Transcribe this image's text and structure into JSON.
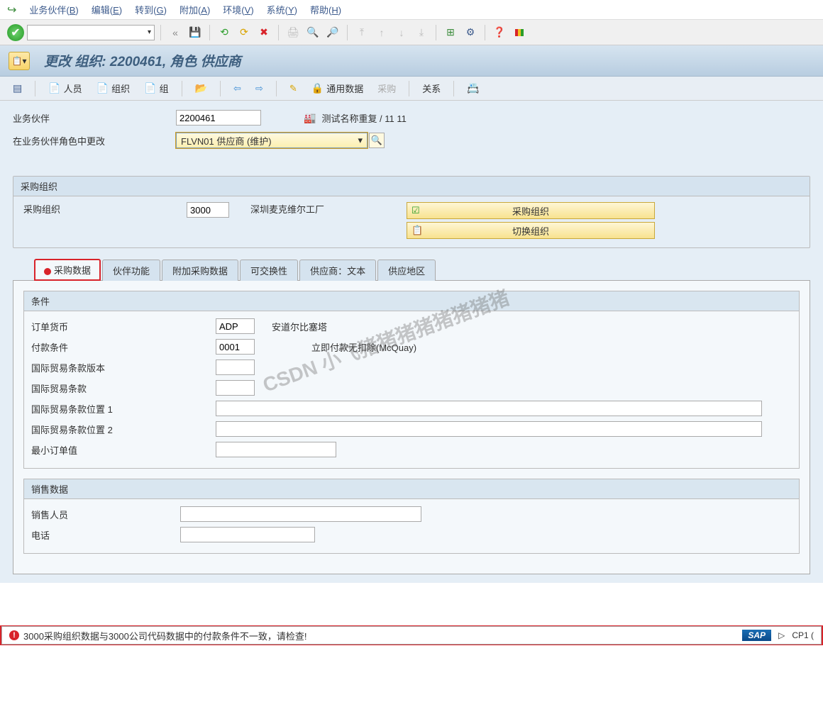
{
  "menubar": {
    "items": [
      {
        "label": "业务伙伴(",
        "key": "B",
        "suffix": ")"
      },
      {
        "label": "编辑(",
        "key": "E",
        "suffix": ")"
      },
      {
        "label": "转到(",
        "key": "G",
        "suffix": ")"
      },
      {
        "label": "附加(",
        "key": "A",
        "suffix": ")"
      },
      {
        "label": "环境(",
        "key": "V",
        "suffix": ")"
      },
      {
        "label": "系统(",
        "key": "Y",
        "suffix": ")"
      },
      {
        "label": "帮助(",
        "key": "H",
        "suffix": ")"
      }
    ]
  },
  "title": "更改 组织: 2200461, 角色 供应商",
  "apptool": {
    "person": "人员",
    "org": "组织",
    "group": "组",
    "general": "通用数据",
    "purchase": "采购",
    "relation": "关系"
  },
  "header_form": {
    "partner_label": "业务伙伴",
    "partner_value": "2200461",
    "partner_desc": "测试名称重复 / 11 11",
    "role_label": "在业务伙伴角色中更改",
    "role_value": "FLVN01 供应商 (维护)"
  },
  "purch_org": {
    "group_title": "采购组织",
    "label": "采购组织",
    "value": "3000",
    "desc": "深圳麦克维尔工厂",
    "btn1": "采购组织",
    "btn2": "切换组织"
  },
  "tabs": {
    "t1": "采购数据",
    "t2": "伙伴功能",
    "t3": "附加采购数据",
    "t4": "可交换性",
    "t5": "供应商：文本",
    "t6": "供应地区"
  },
  "cond_group": {
    "title": "条件",
    "order_currency_label": "订单货币",
    "order_currency_value": "ADP",
    "order_currency_desc": "安道尔比塞塔",
    "pay_terms_label": "付款条件",
    "pay_terms_value": "0001",
    "pay_terms_desc": "立即付款无扣除(McQuay)",
    "incoterms_ver_label": "国际贸易条款版本",
    "incoterms_label": "国际贸易条款",
    "incoterms_loc1_label": "国际贸易条款位置 1",
    "incoterms_loc2_label": "国际贸易条款位置 2",
    "min_order_label": "最小订单值"
  },
  "sales_group": {
    "title": "销售数据",
    "salesperson_label": "销售人员",
    "phone_label": "电话"
  },
  "status": {
    "message": "3000采购组织数据与3000公司代码数据中的付款条件不一致，请检查!",
    "sap": "SAP",
    "session": "CP1 ("
  },
  "watermark": "CSDN 小飞猪猪猪猪猪猪猪猪",
  "icons": {
    "check": "✔",
    "back": "«",
    "save": "💾",
    "dropdown": "▼"
  }
}
